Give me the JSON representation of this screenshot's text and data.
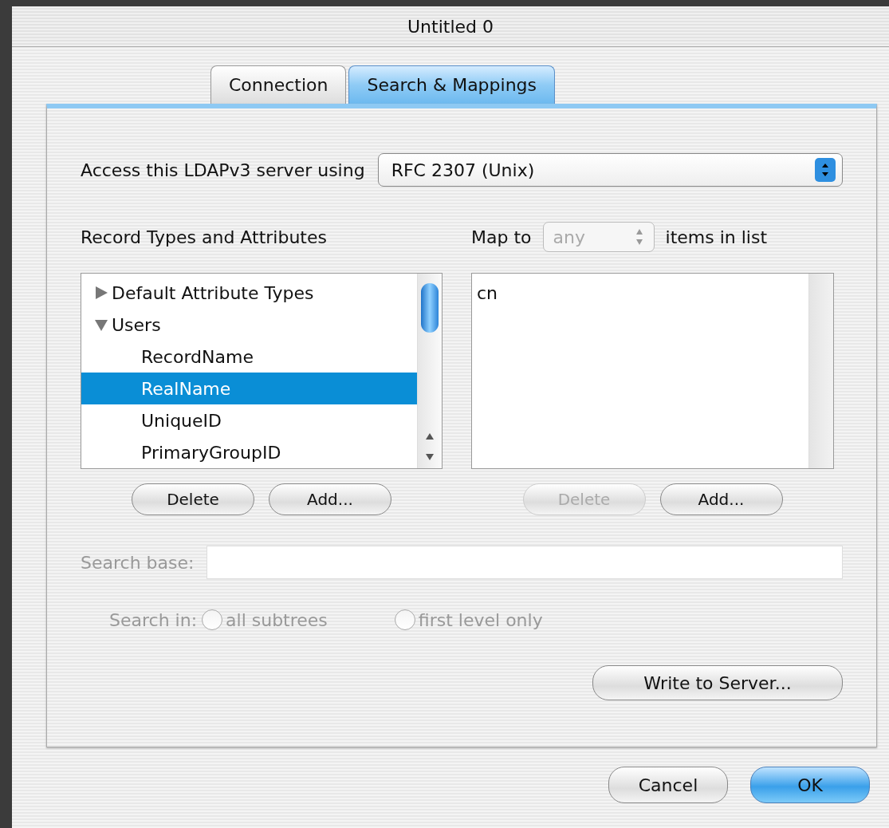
{
  "window": {
    "title": "Untitled 0"
  },
  "tabs": [
    {
      "label": "Connection",
      "selected": false
    },
    {
      "label": "Search & Mappings",
      "selected": true
    }
  ],
  "access": {
    "label": "Access this LDAPv3 server using",
    "value": "RFC 2307 (Unix)"
  },
  "record_types": {
    "heading": "Record Types and Attributes",
    "items": [
      {
        "label": "Default Attribute Types",
        "expanded": false,
        "selected": false
      },
      {
        "label": "Users",
        "expanded": true,
        "selected": false,
        "children": [
          {
            "label": "RecordName",
            "selected": false
          },
          {
            "label": "RealName",
            "selected": true
          },
          {
            "label": "UniqueID",
            "selected": false
          },
          {
            "label": "PrimaryGroupID",
            "selected": false
          }
        ]
      }
    ],
    "buttons": [
      {
        "label": "Delete",
        "disabled": false
      },
      {
        "label": "Add...",
        "disabled": false
      }
    ]
  },
  "mapping": {
    "label": "Map to",
    "value": "any",
    "disabled": true,
    "suffix": "items in list",
    "items": [
      {
        "label": "cn",
        "selected": false
      }
    ],
    "buttons": [
      {
        "label": "Delete",
        "disabled": true
      },
      {
        "label": "Add...",
        "disabled": false
      }
    ]
  },
  "search_base": {
    "label": "Search base:",
    "disabled": true
  },
  "search_in": {
    "label": "Search in:",
    "disabled": true,
    "options": [
      {
        "label": "all subtrees",
        "selected": false
      },
      {
        "label": "first level only",
        "selected": false
      }
    ]
  },
  "write_button": {
    "label": "Write to Server...",
    "disabled": false
  },
  "footer_buttons": [
    {
      "label": "Cancel",
      "default": false
    },
    {
      "label": "OK",
      "default": true
    }
  ]
}
